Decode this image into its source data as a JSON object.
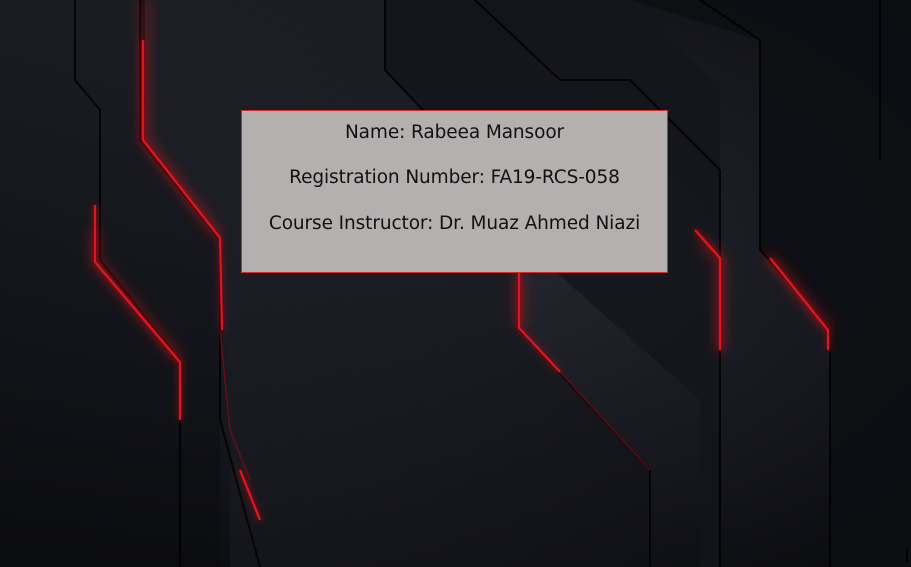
{
  "slide": {
    "background_icon": "dark-geometric-red-glow-background",
    "colors": {
      "background_dark": "#0c0d12",
      "panel_dark": "#1a1c24",
      "accent_red": "#e0161c",
      "box_fill": "#b4b0b0",
      "box_border": "#d62a2a",
      "text": "#111111"
    },
    "info_box": {
      "name_line": "Name: Rabeea Mansoor",
      "registration_line": "Registration Number: FA19-RCS-058",
      "instructor_line": "Course Instructor: Dr. Muaz Ahmed Niazi"
    }
  }
}
